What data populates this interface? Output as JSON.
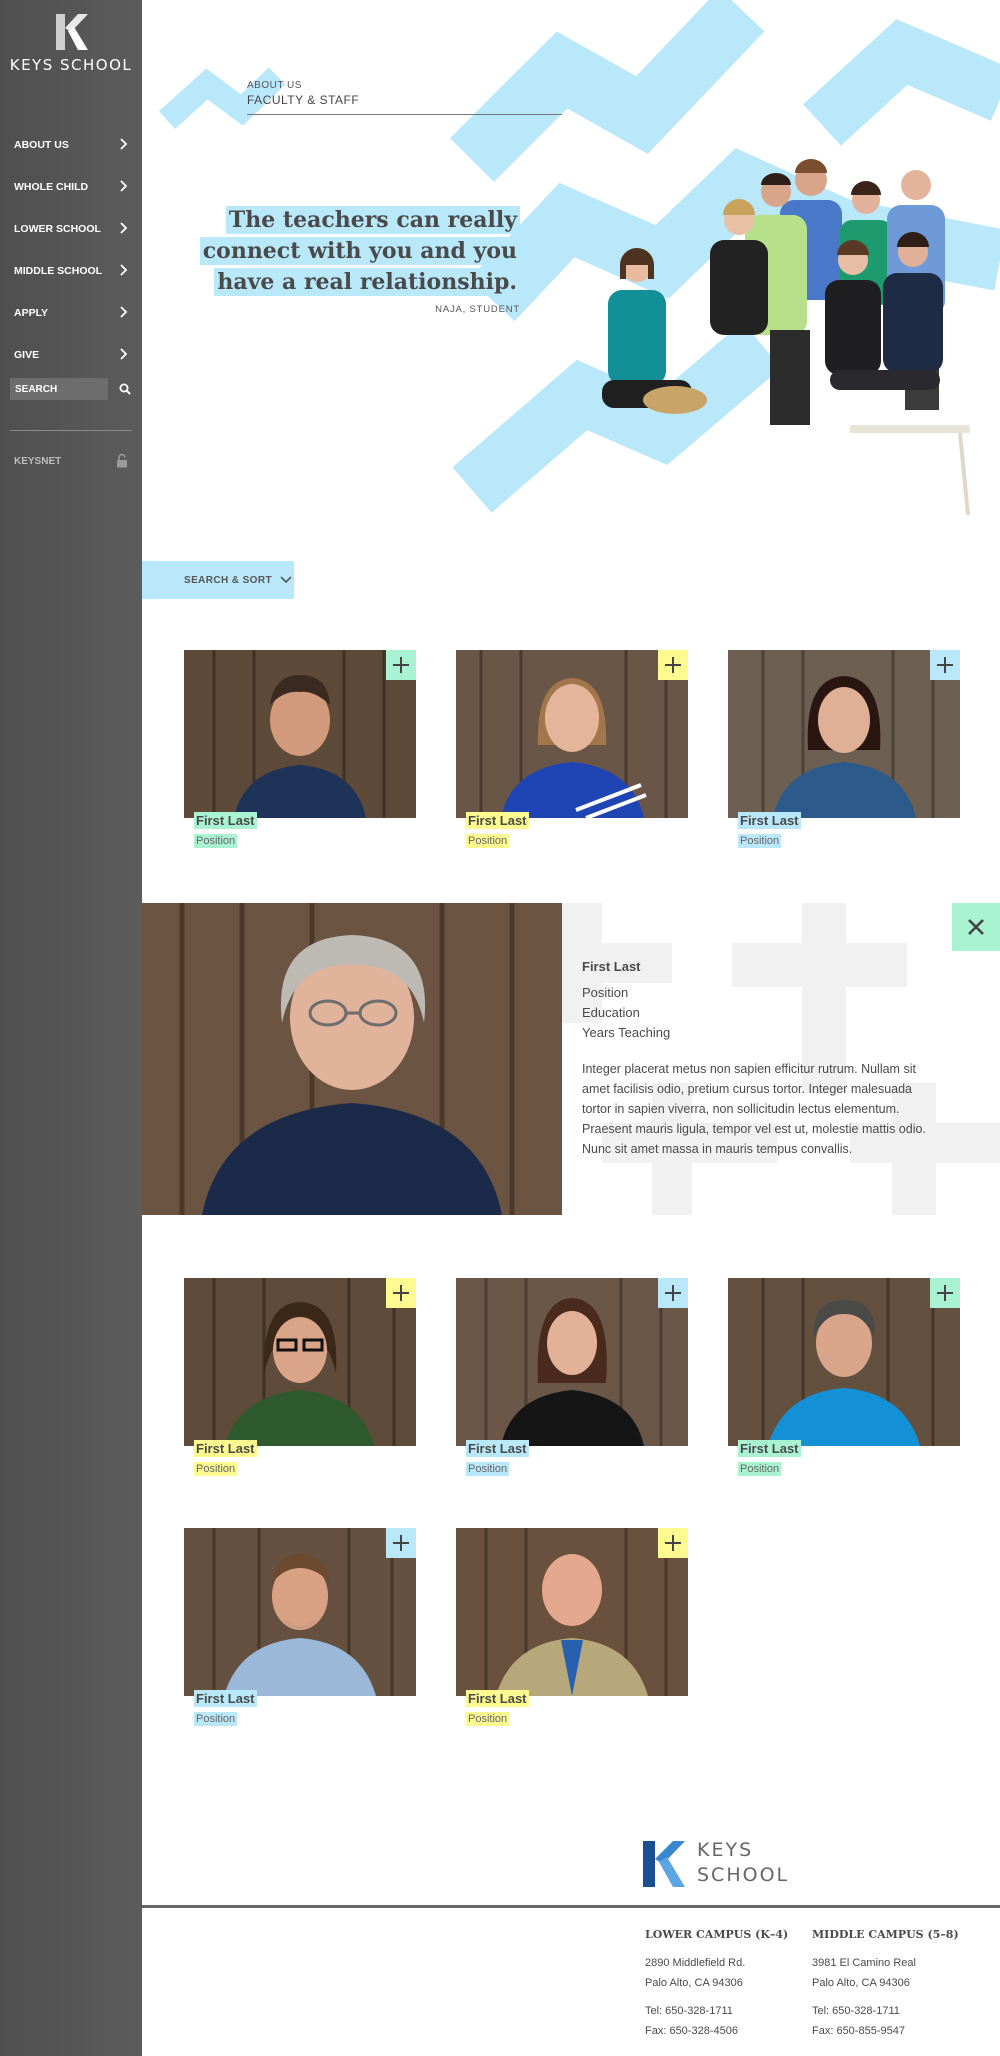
{
  "sidebar": {
    "brand": "KEYS SCHOOL",
    "items": [
      {
        "label": "ABOUT US"
      },
      {
        "label": "WHOLE CHILD"
      },
      {
        "label": "LOWER SCHOOL"
      },
      {
        "label": "MIDDLE SCHOOL"
      },
      {
        "label": "APPLY"
      },
      {
        "label": "GIVE"
      }
    ],
    "search_value": "SEARCH",
    "keysnet": "KEYSNET"
  },
  "hero": {
    "breadcrumb_top": "ABOUT US",
    "breadcrumb_main": "FACULTY & STAFF",
    "quote_lines": [
      "The teachers can really",
      "connect with you and you",
      "have a real relationship."
    ],
    "attribution": "NAJA, STUDENT"
  },
  "search_sort_label": "SEARCH & SORT",
  "staff": [
    {
      "name": "First Last",
      "position": "Position",
      "accent": "green"
    },
    {
      "name": "First Last",
      "position": "Position",
      "accent": "yellow"
    },
    {
      "name": "First Last",
      "position": "Position",
      "accent": "blue"
    },
    {
      "name": "First Last",
      "position": "Position",
      "accent": "yellow"
    },
    {
      "name": "First Last",
      "position": "Position",
      "accent": "blue"
    },
    {
      "name": "First Last",
      "position": "Position",
      "accent": "green"
    },
    {
      "name": "First Last",
      "position": "Position",
      "accent": "blue"
    },
    {
      "name": "First Last",
      "position": "Position",
      "accent": "yellow"
    }
  ],
  "profile": {
    "name": "First Last",
    "position": "Position",
    "education": "Education",
    "years": "Years Teaching",
    "bio": "Integer placerat metus non sapien efficitur rutrum. Nullam sit amet facilisis odio, pretium cursus tortor. Integer malesuada tortor in sapien viverra, non sollicitudin lectus elementum. Praesent mauris ligula, tempor vel est ut, molestie mattis odio. Nunc sit amet massa in mauris tempus convallis."
  },
  "footer": {
    "logo_line1": "KEYS",
    "logo_line2": "SCHOOL",
    "lower": {
      "title": "LOWER CAMPUS (K–4)",
      "addr1": "2890 Middlefield Rd.",
      "addr2": "Palo Alto, CA 94306",
      "tel": "Tel: 650-328-1711",
      "fax": "Fax: 650-328-4506"
    },
    "middle": {
      "title": "MIDDLE CAMPUS (5–8)",
      "addr1": "3981 El Camino Real",
      "addr2": "Palo Alto, CA 94306",
      "tel": "Tel: 650-328-1711",
      "fax": "Fax: 650-855-9547"
    }
  },
  "colors": {
    "sidebar": "#555555",
    "accent_blue": "#b8e8fa",
    "accent_green": "#aaf3d2",
    "accent_yellow": "#fdfa8f",
    "brand_blue": "#2a6fb8"
  }
}
